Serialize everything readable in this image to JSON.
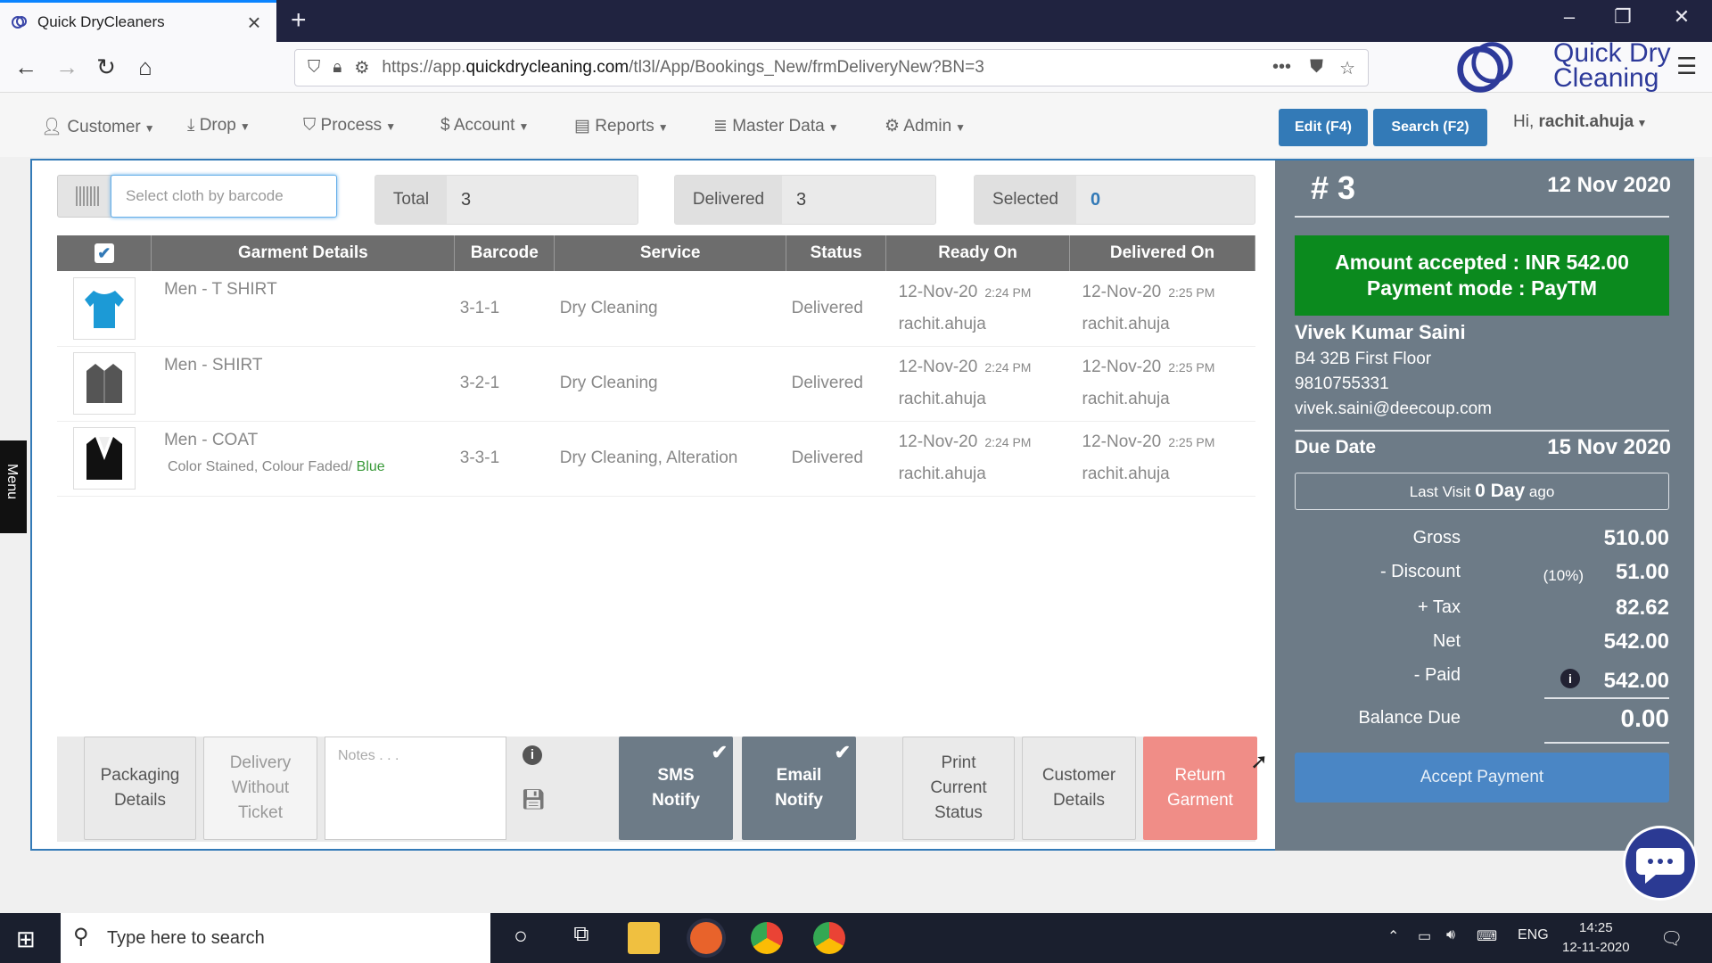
{
  "browser": {
    "tab_title": "Quick DryCleaners",
    "url_prefix": "https://app.",
    "url_domain": "quickdrycleaning.com",
    "url_path": "/tl3l/App/Bookings_New/frmDeliveryNew?BN=3",
    "brand_line1": "Quick Dry",
    "brand_line2": "Cleaning"
  },
  "menu": {
    "customer": "Customer",
    "drop": "Drop",
    "process": "Process",
    "account": "Account",
    "reports": "Reports",
    "master_data": "Master Data",
    "admin": "Admin",
    "edit_btn": "Edit (F4)",
    "search_btn": "Search (F2)",
    "greeting": "Hi,",
    "user": "rachit.ahuja"
  },
  "toolbar": {
    "barcode_placeholder": "Select cloth by barcode",
    "total_label": "Total",
    "total_value": "3",
    "delivered_label": "Delivered",
    "delivered_value": "3",
    "selected_label": "Selected",
    "selected_value": "0"
  },
  "table": {
    "headers": [
      "Garment Details",
      "Barcode",
      "Service",
      "Status",
      "Ready On",
      "Delivered On"
    ],
    "rows": [
      {
        "title": "Men - T SHIRT",
        "sub": "",
        "sub_color": "",
        "barcode": "3-1-1",
        "service": "Dry Cleaning",
        "status": "Delivered",
        "ready_date": "12-Nov-20",
        "ready_time": "2:24 PM",
        "ready_user": "rachit.ahuja",
        "del_date": "12-Nov-20",
        "del_time": "2:25 PM",
        "del_user": "rachit.ahuja"
      },
      {
        "title": "Men - SHIRT",
        "sub": "",
        "sub_color": "",
        "barcode": "3-2-1",
        "service": "Dry Cleaning",
        "status": "Delivered",
        "ready_date": "12-Nov-20",
        "ready_time": "2:24 PM",
        "ready_user": "rachit.ahuja",
        "del_date": "12-Nov-20",
        "del_time": "2:25 PM",
        "del_user": "rachit.ahuja"
      },
      {
        "title": "Men - COAT",
        "sub": "Color Stained, Colour Faded/",
        "sub_color": "Blue",
        "barcode": "3-3-1",
        "service": "Dry Cleaning, Alteration",
        "status": "Delivered",
        "ready_date": "12-Nov-20",
        "ready_time": "2:24 PM",
        "ready_user": "rachit.ahuja",
        "del_date": "12-Nov-20",
        "del_time": "2:25 PM",
        "del_user": "rachit.ahuja"
      }
    ]
  },
  "actions": {
    "packaging_1": "Packaging",
    "packaging_2": "Details",
    "dwt_1": "Delivery",
    "dwt_2": "Without",
    "dwt_3": "Ticket",
    "notes_placeholder": "Notes . . .",
    "sms_1": "SMS",
    "sms_2": "Notify",
    "email_1": "Email",
    "email_2": "Notify",
    "print_1": "Print",
    "print_2": "Current",
    "print_3": "Status",
    "cust_1": "Customer",
    "cust_2": "Details",
    "return_1": "Return",
    "return_2": "Garment"
  },
  "summary": {
    "booking_no": "# 3",
    "booking_date": "12 Nov 2020",
    "amount_line": "Amount accepted : INR 542.00",
    "mode_line": "Payment mode : PayTM",
    "customer_name": "Vivek Kumar Saini",
    "address": "B4 32B First Floor",
    "phone": "9810755331",
    "email": "vivek.saini@deecoup.com",
    "due_label": "Due Date",
    "due_value": "15 Nov 2020",
    "last_visit_pre": "Last Visit",
    "last_visit_val": "0 Day",
    "last_visit_post": "ago",
    "gross_label": "Gross",
    "gross_value": "510.00",
    "discount_label": "- Discount",
    "discount_pct": "(10%)",
    "discount_value": "51.00",
    "tax_label": "+ Tax",
    "tax_value": "82.62",
    "net_label": "Net",
    "net_value": "542.00",
    "paid_label": "- Paid",
    "paid_value": "542.00",
    "balance_label": "Balance Due",
    "balance_value": "0.00",
    "accept_btn": "Accept Payment"
  },
  "side_menu": "Menu",
  "taskbar": {
    "search_text": "Type here to search",
    "lang": "ENG",
    "time": "14:25",
    "date": "12-11-2020"
  },
  "colors": {
    "accent_blue": "#337ab7",
    "summary_bg": "#6d7b87",
    "amount_green": "#0b8a1e",
    "return_red": "#f08d87"
  }
}
